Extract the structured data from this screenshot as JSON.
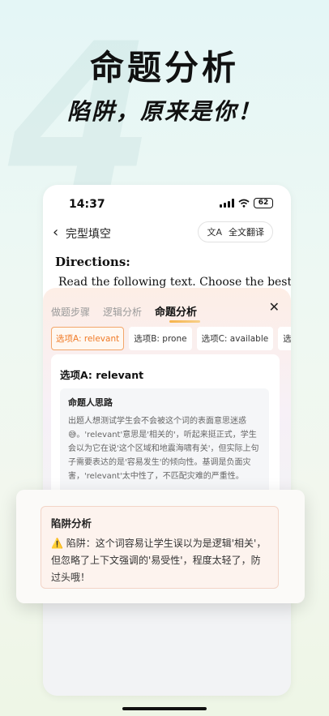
{
  "hero": {
    "title": "命题分析",
    "subtitle": "陷阱，原来是你！",
    "bg_number": "4"
  },
  "status_bar": {
    "time": "14:37",
    "battery": "62"
  },
  "nav": {
    "back_icon": "‹",
    "title": "完型填空",
    "translate_icon": "文A",
    "translate_label": "全文翻译"
  },
  "passage": {
    "directions_label": "Directions:",
    "directions_text": "Read the following text. Choose the best"
  },
  "sheet": {
    "tabs": [
      {
        "label": "做题步骤"
      },
      {
        "label": "逻辑分析"
      },
      {
        "label": "命题分析"
      }
    ],
    "close_icon": "✕",
    "options": [
      {
        "label": "选项A: relevant"
      },
      {
        "label": "选项B: prone"
      },
      {
        "label": "选项C: available"
      },
      {
        "label": "选"
      }
    ],
    "card": {
      "title": "选项A: relevant",
      "section_title": "命题人思路",
      "section_body": "出题人想测试学生会不会被这个词的表面意思迷惑😅。'relevant'意思是'相关的'，听起来挺正式，学生会以为它在说'这个区域和地震海啸有关'，但实际上句子需要表达的是'容易发生'的倾向性。基调是负面灾害，'relevant'太中性了，不匹配灾难的严重性。"
    }
  },
  "trap": {
    "title": "陷阱分析",
    "body": "⚠️ 陷阱：这个词容易让学生误以为是逻辑'相关'，但忽略了上下文强调的'易受性'，程度太轻了，防过头哦！"
  }
}
